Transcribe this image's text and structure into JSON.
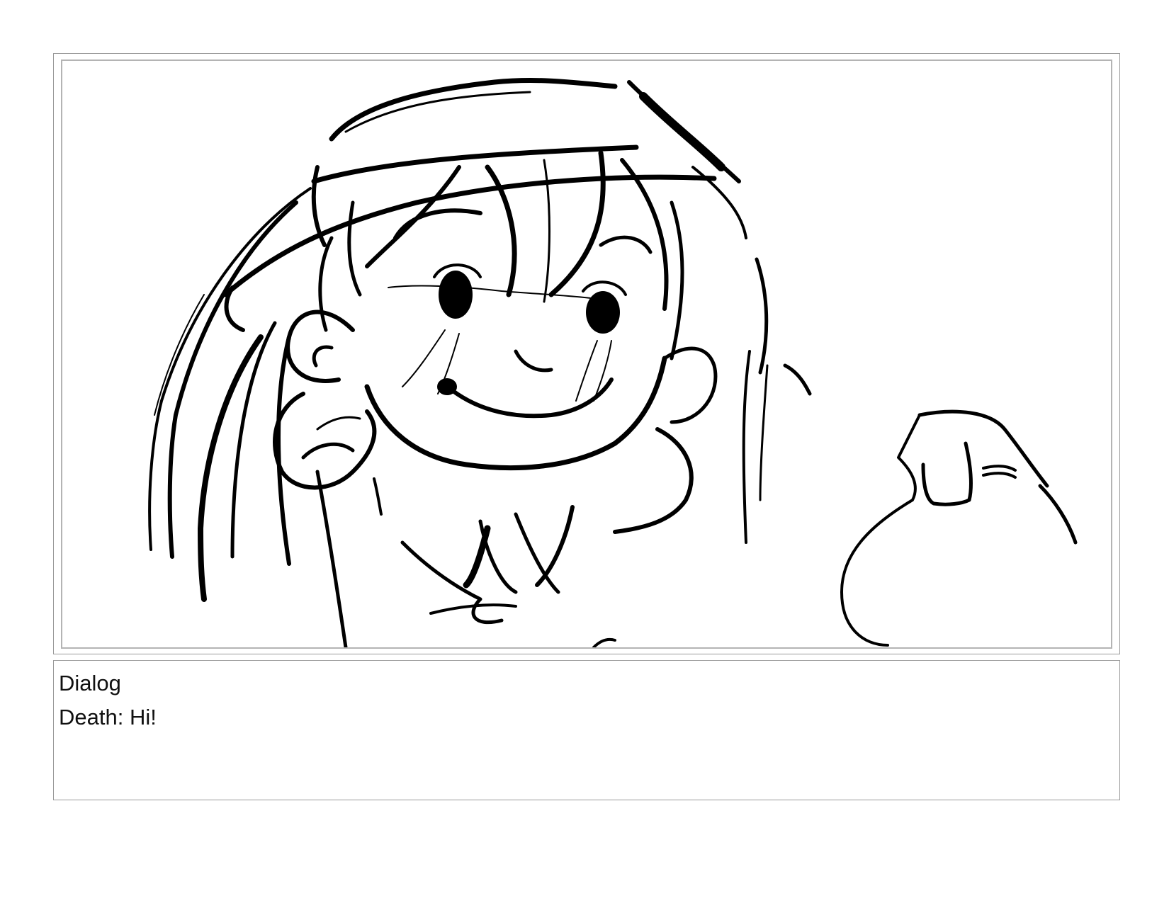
{
  "storyboard": {
    "panel": {
      "illustration": "sketch-character-waving"
    },
    "dialog": {
      "heading": "Dialog",
      "lines": [
        "Death: Hi!"
      ]
    }
  }
}
